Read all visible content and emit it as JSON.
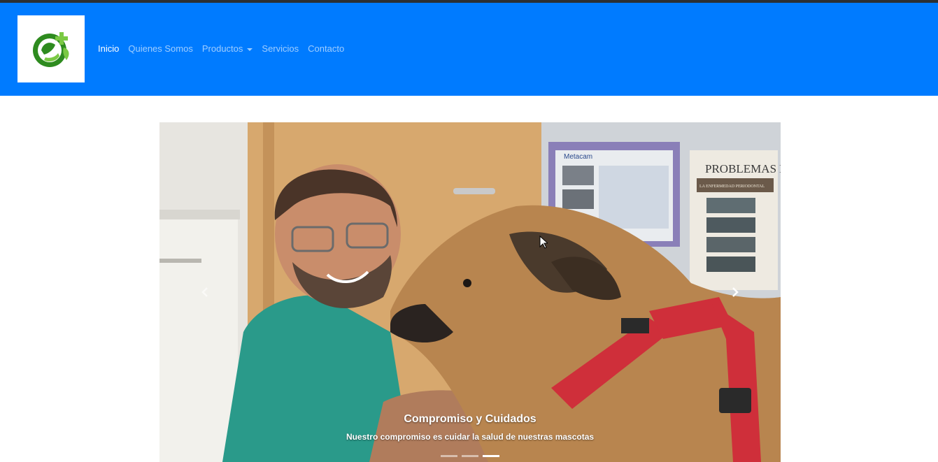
{
  "nav": {
    "logo_alt": "veterinaria-logo",
    "items": [
      {
        "label": "Inicio",
        "active": true
      },
      {
        "label": "Quienes Somos"
      },
      {
        "label": "Productos",
        "dropdown": true
      },
      {
        "label": "Servicios"
      },
      {
        "label": "Contacto"
      }
    ]
  },
  "carousel": {
    "caption_title": "Compromiso y Cuidados",
    "caption_text": "Nuestro compromiso es cuidar la salud de nuestras mascotas",
    "slide_count": 3,
    "active_slide": 3,
    "poster_texts": [
      "Metacam",
      "PROBLEMAS D",
      "LA ENFERMEDAD PERIODONTAL"
    ]
  },
  "colors": {
    "navbar": "#007bff",
    "logo_green": "#2e8b1f",
    "logo_light_green": "#7ac943"
  }
}
